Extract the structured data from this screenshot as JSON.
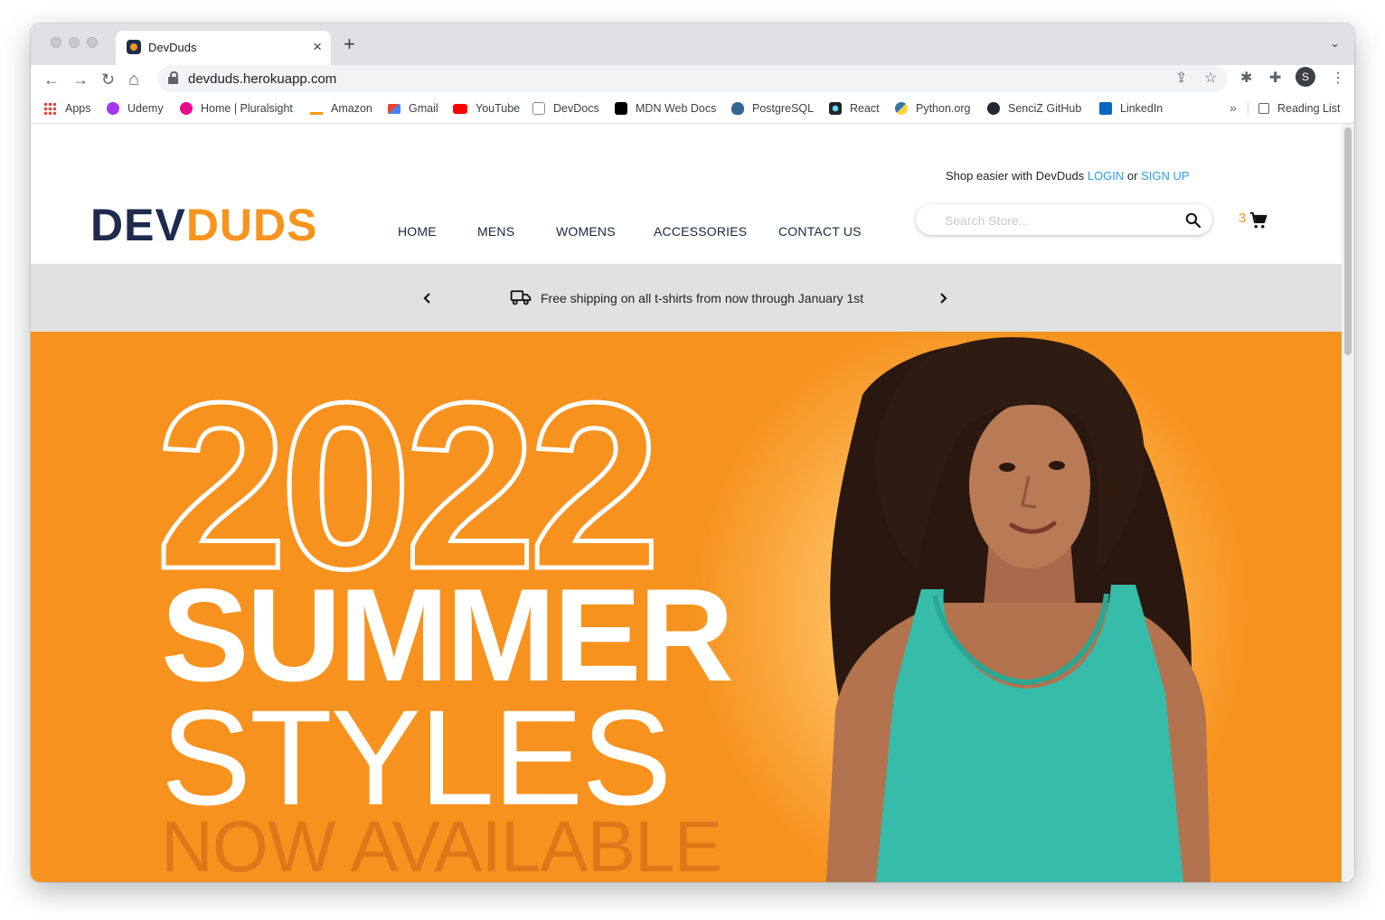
{
  "browser": {
    "tab_title": "DevDuds",
    "tab_close": "×",
    "new_tab": "+",
    "tab_menu": "⌄",
    "nav_back": "←",
    "nav_forward": "→",
    "nav_reload": "↻",
    "nav_home": "⌂",
    "url": "devduds.herokuapp.com",
    "share_icon": "⇪",
    "star_icon": "☆",
    "ext_icon_1": "✱",
    "ext_icon_2": "✚",
    "profile_initial": "S",
    "menu_icon": "⋮",
    "bookmarks_more": "»",
    "reading_list": "Reading List"
  },
  "bookmarks": [
    {
      "label": "Apps",
      "color": "#ea4335"
    },
    {
      "label": "Udemy",
      "color": "#a435f0"
    },
    {
      "label": "Home | Pluralsight",
      "color": "#e80a89"
    },
    {
      "label": "Amazon",
      "color": "#111111"
    },
    {
      "label": "Gmail",
      "color": "#ea4335"
    },
    {
      "label": "YouTube",
      "color": "#ff0000"
    },
    {
      "label": "DevDocs",
      "color": "#8a8a8a"
    },
    {
      "label": "MDN Web Docs",
      "color": "#000000"
    },
    {
      "label": "PostgreSQL",
      "color": "#336791"
    },
    {
      "label": "React",
      "color": "#20232a"
    },
    {
      "label": "Python.org",
      "color": "#3776ab"
    },
    {
      "label": "SenciZ GitHub",
      "color": "#24292e"
    },
    {
      "label": "LinkedIn",
      "color": "#0a66c2"
    }
  ],
  "site": {
    "promo_prefix": "Shop easier with DevDuds",
    "login": "LOGIN",
    "or": "or",
    "signup": "SIGN UP",
    "logo_dev": "DEV",
    "logo_duds": "DUDS",
    "nav": [
      "HOME",
      "MENS",
      "WOMENS",
      "ACCESSORIES",
      "CONTACT US"
    ],
    "search_placeholder": "Search Store...",
    "cart_count": "3",
    "banner_text": "Free shipping on all t-shirts from now through January 1st",
    "hero": {
      "year": "2022",
      "line1": "SUMMER",
      "line2": "STYLES",
      "line3": "NOW AVAILABLE"
    }
  },
  "colors": {
    "brand_orange": "#f7941d",
    "brand_navy": "#1e2b4f",
    "link_blue": "#2b9fe0",
    "banner_gray": "#e1e1e1",
    "hero_orange": "#f7921e"
  }
}
